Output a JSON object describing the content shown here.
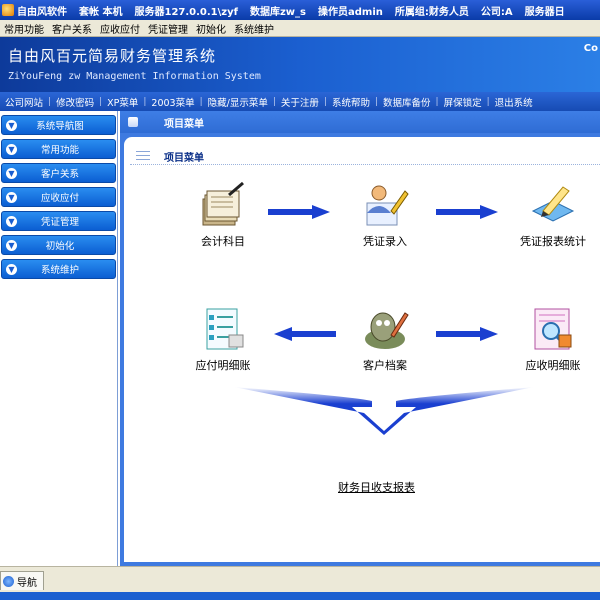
{
  "titlebar": {
    "segments": [
      "自由风软件",
      "套帐 本机",
      "服务器127.0.0.1\\zyf",
      "数据库zw_s",
      "操作员admin",
      "所属组:财务人员",
      "公司:A",
      "服务器日"
    ]
  },
  "menubar": {
    "items": [
      "常用功能",
      "客户关系",
      "应收应付",
      "凭证管理",
      "初始化",
      "系统维护"
    ]
  },
  "banner": {
    "title_cn": "自由风百元简易财务管理系统",
    "title_en": "ZiYouFeng zw Management Information System",
    "corner": "Co"
  },
  "linkbar": {
    "items": [
      "公司网站",
      "修改密码",
      "XP菜单",
      "2003菜单",
      "隐藏/显示菜单",
      "关于注册",
      "系统帮助",
      "数据库备份",
      "屏保锁定",
      "退出系统"
    ]
  },
  "sidebar": {
    "items": [
      "系统导航图",
      "常用功能",
      "客户关系",
      "应收应付",
      "凭证管理",
      "初始化",
      "系统维护"
    ]
  },
  "main": {
    "header_title": "项目菜单",
    "sub_title": "项目菜单",
    "nodes": {
      "accounts": "会计科目",
      "voucher_entry": "凭证录入",
      "voucher_report": "凭证报表统计",
      "payable_detail": "应付明细账",
      "customer_file": "客户档案",
      "receivable_detail": "应收明细账"
    },
    "report_link": "财务日收支报表"
  },
  "statusbar": {
    "tab_label": "导航"
  },
  "colors": {
    "accent_blue": "#1b5fd0",
    "arrow_blue": "#1a3fd0",
    "menu_bg": "#ece9d8"
  }
}
